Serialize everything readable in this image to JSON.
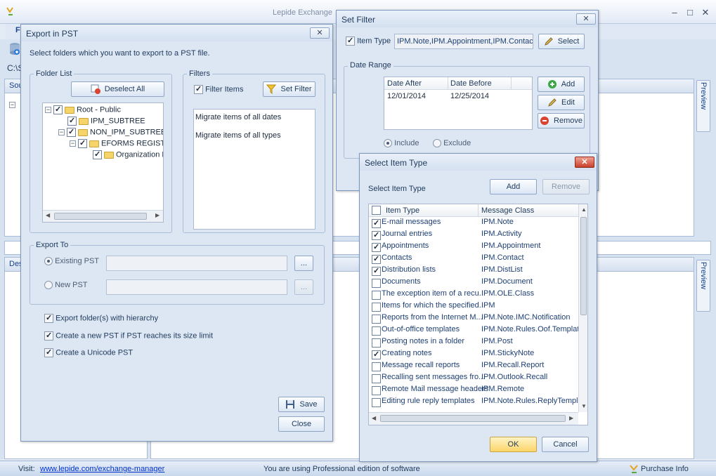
{
  "main": {
    "title": "Lepide Exchange",
    "menu_first_letter": "F",
    "path_prefix": "C:\\S",
    "source_label": "Sou",
    "dest_label": "Des",
    "preview_label": "Preview",
    "status": {
      "visit_label": "Visit:",
      "visit_url": "www.lepide.com/exchange-manager",
      "edition_text": "You are using Professional edition of software",
      "purchase_label": "Purchase Info"
    }
  },
  "export_dialog": {
    "title": "Export in PST",
    "instruction": "Select folders which you want to export to a PST file.",
    "folder_list_label": "Folder List",
    "deselect_all_label": "Deselect All",
    "tree": [
      {
        "label": "Root - Public",
        "checked": true
      },
      {
        "label": "IPM_SUBTREE",
        "checked": true
      },
      {
        "label": "NON_IPM_SUBTREE",
        "checked": true
      },
      {
        "label": "EFORMS REGISTRY",
        "checked": true
      },
      {
        "label": "Organization For",
        "checked": true
      }
    ],
    "filters_label": "Filters",
    "filter_items_label": "Filter Items",
    "set_filter_label": "Set Filter",
    "filter_summary": [
      "Migrate items of all dates",
      "Migrate items of all types"
    ],
    "export_to_label": "Export To",
    "existing_pst_label": "Existing PST",
    "new_pst_label": "New PST",
    "browse_label": "...",
    "options": [
      {
        "label": "Export folder(s) with hierarchy",
        "checked": true
      },
      {
        "label": "Create a new PST if PST reaches its size limit",
        "checked": true
      },
      {
        "label": "Create a Unicode PST",
        "checked": true
      }
    ],
    "save_label": "Save",
    "close_label": "Close"
  },
  "set_filter_dialog": {
    "title": "Set Filter",
    "item_type_label": "Item Type",
    "item_type_value": "IPM.Note,IPM.Appointment,IPM.Contact,IPM",
    "select_label": "Select",
    "date_range_label": "Date Range",
    "columns": [
      "Date After",
      "Date Before"
    ],
    "rows": [
      [
        "12/01/2014",
        "12/25/2014"
      ]
    ],
    "add_label": "Add",
    "edit_label": "Edit",
    "remove_label": "Remove",
    "include_label": "Include",
    "exclude_label": "Exclude"
  },
  "select_item_dialog": {
    "title": "Select Item Type",
    "subtitle": "Select Item Type",
    "add_label": "Add",
    "remove_label": "Remove",
    "columns": [
      "Item Type",
      "Message Class"
    ],
    "rows": [
      {
        "type": "E-mail messages",
        "cls": "IPM.Note",
        "checked": true
      },
      {
        "type": "Journal entries",
        "cls": "IPM.Activity",
        "checked": true
      },
      {
        "type": "Appointments",
        "cls": "IPM.Appointment",
        "checked": true
      },
      {
        "type": "Contacts",
        "cls": "IPM.Contact",
        "checked": true
      },
      {
        "type": "Distribution lists",
        "cls": "IPM.DistList",
        "checked": true
      },
      {
        "type": "Documents",
        "cls": "IPM.Document",
        "checked": false
      },
      {
        "type": "The exception item of a recu...",
        "cls": "IPM.OLE.Class",
        "checked": false
      },
      {
        "type": "Items for which the specified...",
        "cls": "IPM",
        "checked": false
      },
      {
        "type": "Reports from the Internet M...",
        "cls": "IPM.Note.IMC.Notification",
        "checked": false
      },
      {
        "type": "Out-of-office templates",
        "cls": "IPM.Note.Rules.Oof.Template...",
        "checked": false
      },
      {
        "type": "Posting notes in a folder",
        "cls": "IPM.Post",
        "checked": false
      },
      {
        "type": "Creating notes",
        "cls": "IPM.StickyNote",
        "checked": true
      },
      {
        "type": "Message recall reports",
        "cls": "IPM.Recall.Report",
        "checked": false
      },
      {
        "type": "Recalling sent messages fro...",
        "cls": "IPM.Outlook.Recall",
        "checked": false
      },
      {
        "type": "Remote Mail message headers",
        "cls": "IPM.Remote",
        "checked": false
      },
      {
        "type": "Editing rule reply templates",
        "cls": "IPM.Note.Rules.ReplyTemplat...",
        "checked": false
      }
    ],
    "ok_label": "OK",
    "cancel_label": "Cancel"
  },
  "colors": {
    "accent": "#15428b",
    "ok_button": "#fbd569",
    "link": "#0033cc"
  }
}
